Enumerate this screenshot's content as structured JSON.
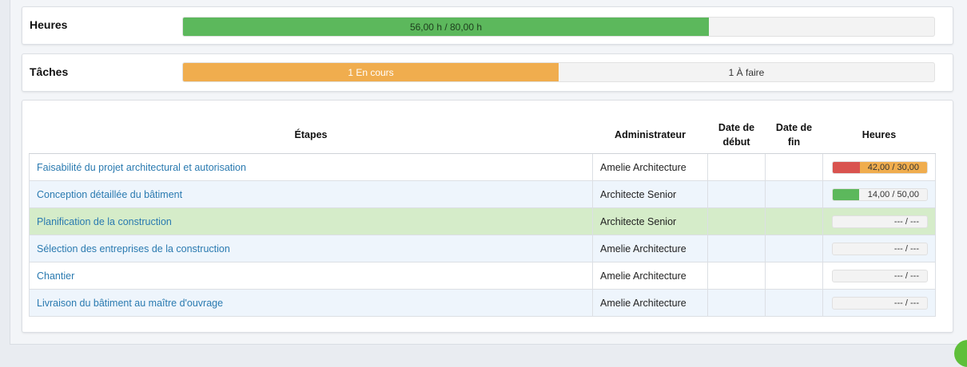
{
  "heures": {
    "label": "Heures",
    "text": "56,00 h / 80,00 h",
    "progress": 0.7,
    "color": "#5cb85c"
  },
  "taches": {
    "label": "Tâches",
    "in_progress_label": "1 En cours",
    "todo_label": "1 À faire",
    "in_progress_fraction": 0.5,
    "color": "#f0ad4e"
  },
  "table": {
    "headers": {
      "etapes": "Étapes",
      "administrateur": "Administrateur",
      "date_debut": "Date de début",
      "date_fin": "Date de fin",
      "heures": "Heures"
    },
    "rows": [
      {
        "name": "Faisabilité du projet architectural et autorisation",
        "admin": "Amelie Architecture",
        "date_debut": "",
        "date_fin": "",
        "hours_text": "42,00 / 30,00",
        "done": 42,
        "planned": 30
      },
      {
        "name": "Conception détaillée du bâtiment",
        "admin": "Architecte Senior",
        "date_debut": "",
        "date_fin": "",
        "hours_text": "14,00 / 50,00",
        "done": 14,
        "planned": 50
      },
      {
        "name": "Planification de la construction",
        "admin": "Architecte Senior",
        "date_debut": "",
        "date_fin": "",
        "hours_text": "--- / ---",
        "done": 0,
        "planned": 0
      },
      {
        "name": "Sélection des entreprises de la construction",
        "admin": "Amelie Architecture",
        "date_debut": "",
        "date_fin": "",
        "hours_text": "--- / ---",
        "done": 0,
        "planned": 0
      },
      {
        "name": "Chantier",
        "admin": "Amelie Architecture",
        "date_debut": "",
        "date_fin": "",
        "hours_text": "--- / ---",
        "done": 0,
        "planned": 0
      },
      {
        "name": "Livraison du bâtiment au maître d'ouvrage",
        "admin": "Amelie Architecture",
        "date_debut": "",
        "date_fin": "",
        "hours_text": "--- / ---",
        "done": 0,
        "planned": 0
      }
    ]
  },
  "colors": {
    "over_budget": "#d9534f",
    "planned": "#f0ad4e",
    "ok": "#5cb85c",
    "link": "#2a7ab0",
    "highlight_row": "#d5ecc9"
  }
}
